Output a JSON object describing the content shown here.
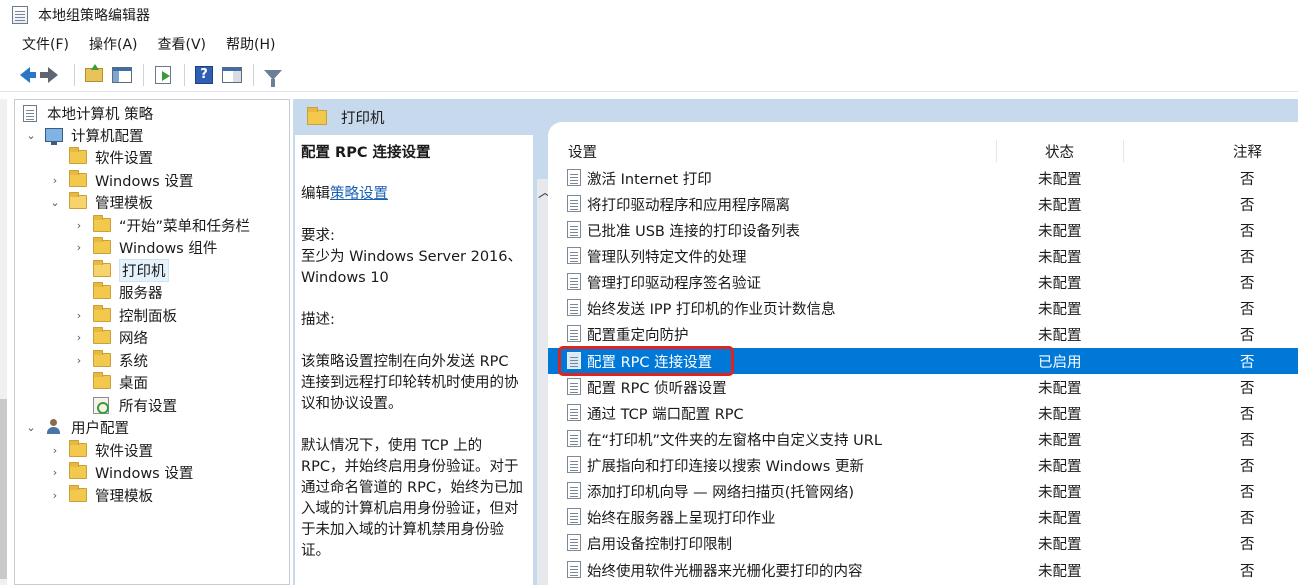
{
  "window": {
    "title": "本地组策略编辑器"
  },
  "menu": [
    "文件(F)",
    "操作(A)",
    "查看(V)",
    "帮助(H)"
  ],
  "toolbar": {
    "buttons": [
      "back-icon",
      "forward-icon",
      "up-folder-icon",
      "show-tree-icon",
      "export-list-icon",
      "help-icon",
      "properties-icon",
      "filter-icon"
    ],
    "help_glyph": "?"
  },
  "tree": {
    "root": "本地计算机 策略",
    "computer_config": "计算机配置",
    "computer_children": {
      "software": "软件设置",
      "windows": "Windows 设置",
      "admin_templates": "管理模板"
    },
    "admin_children": {
      "start_menu": "“开始”菜单和任务栏",
      "win_components": "Windows 组件",
      "printers": "打印机",
      "servers": "服务器",
      "control_panel": "控制面板",
      "network": "网络",
      "system": "系统",
      "desktop": "桌面",
      "all_settings": "所有设置"
    },
    "user_config": "用户配置",
    "user_children": {
      "software": "软件设置",
      "windows": "Windows 设置",
      "admin_templates": "管理模板"
    }
  },
  "right": {
    "header": "打印机",
    "description": {
      "title": "配置 RPC 连接设置",
      "edit_prefix": "编辑",
      "edit_link": "策略设置",
      "requirements_label": "要求:",
      "requirements_text": "至少为 Windows Server 2016、Windows 10",
      "description_label": "描述:",
      "para1": "该策略设置控制在向外发送 RPC 连接到远程打印轮转机时使用的协议和协议设置。",
      "para2": "默认情况下，使用 TCP 上的 RPC，并始终启用身份验证。对于通过命名管道的 RPC，始终为已加入域的计算机启用身份验证，但对于未加入域的计算机禁用身份验证。"
    },
    "columns": {
      "setting": "设置",
      "state": "状态",
      "note": "注释"
    },
    "rows": [
      {
        "name": "激活 Internet 打印",
        "state": "未配置",
        "note": "否"
      },
      {
        "name": "将打印驱动程序和应用程序隔离",
        "state": "未配置",
        "note": "否"
      },
      {
        "name": "已批准 USB 连接的打印设备列表",
        "state": "未配置",
        "note": "否"
      },
      {
        "name": "管理队列特定文件的处理",
        "state": "未配置",
        "note": "否"
      },
      {
        "name": "管理打印驱动程序签名验证",
        "state": "未配置",
        "note": "否"
      },
      {
        "name": "始终发送 IPP 打印机的作业页计数信息",
        "state": "未配置",
        "note": "否"
      },
      {
        "name": "配置重定向防护",
        "state": "未配置",
        "note": "否"
      },
      {
        "name": "配置 RPC 连接设置",
        "state": "已启用",
        "note": "否"
      },
      {
        "name": "配置 RPC 侦听器设置",
        "state": "未配置",
        "note": "否"
      },
      {
        "name": "通过 TCP 端口配置 RPC",
        "state": "未配置",
        "note": "否"
      },
      {
        "name": "在“打印机”文件夹的左窗格中自定义支持 URL",
        "state": "未配置",
        "note": "否"
      },
      {
        "name": "扩展指向和打印连接以搜索 Windows 更新",
        "state": "未配置",
        "note": "否"
      },
      {
        "name": "添加打印机向导 — 网络扫描页(托管网络)",
        "state": "未配置",
        "note": "否"
      },
      {
        "name": "始终在服务器上呈现打印作业",
        "state": "未配置",
        "note": "否"
      },
      {
        "name": "启用设备控制打印限制",
        "state": "未配置",
        "note": "否"
      },
      {
        "name": "始终使用软件光栅器来光栅化要打印的内容",
        "state": "未配置",
        "note": "否"
      }
    ],
    "selected_row": "配置 RPC 连接设置",
    "colors": {
      "selection": "#0078d7",
      "highlight_box": "#e0231e"
    }
  }
}
